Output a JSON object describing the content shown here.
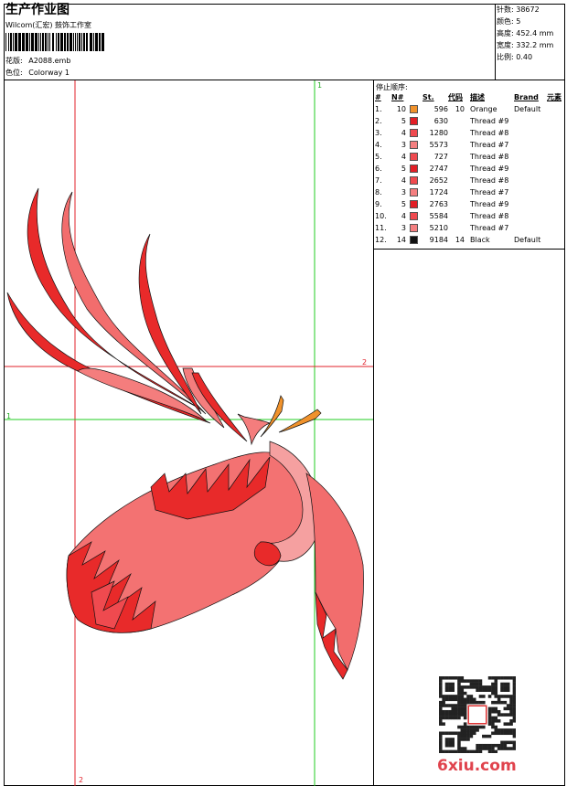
{
  "header": {
    "title": "生产作业图",
    "subtitle": "Wilcom(汇宏) 鼓饰工作室",
    "design_label": "花版:",
    "design_file": "A2088.emb",
    "color_label": "色位:",
    "colorway": "Colorway 1"
  },
  "stats": [
    {
      "label": "针数:",
      "value": "38672"
    },
    {
      "label": "颜色:",
      "value": "5"
    },
    {
      "label": "高度:",
      "value": "452.4 mm"
    },
    {
      "label": "宽度:",
      "value": "332.2 mm"
    },
    {
      "label": "比例:",
      "value": "0.40"
    }
  ],
  "stop_sequence": {
    "title": "停止顺序:",
    "headers": [
      "#",
      "N#",
      "",
      "St.",
      "代码",
      "描述",
      "Brand",
      "元素"
    ],
    "rows": [
      {
        "n": "1.",
        "needle": "10",
        "color": "#f0922c",
        "stitches": "596",
        "code": "10",
        "desc": "Orange",
        "brand": "Default"
      },
      {
        "n": "2.",
        "needle": "5",
        "color": "#e21e26",
        "stitches": "630",
        "code": "",
        "desc": "Thread #9",
        "brand": ""
      },
      {
        "n": "3.",
        "needle": "4",
        "color": "#ef4a4f",
        "stitches": "1280",
        "code": "",
        "desc": "Thread #8",
        "brand": ""
      },
      {
        "n": "4.",
        "needle": "3",
        "color": "#f47f80",
        "stitches": "5573",
        "code": "",
        "desc": "Thread #7",
        "brand": ""
      },
      {
        "n": "5.",
        "needle": "4",
        "color": "#ef4a4f",
        "stitches": "727",
        "code": "",
        "desc": "Thread #8",
        "brand": ""
      },
      {
        "n": "6.",
        "needle": "5",
        "color": "#e21e26",
        "stitches": "2747",
        "code": "",
        "desc": "Thread #9",
        "brand": ""
      },
      {
        "n": "7.",
        "needle": "4",
        "color": "#ef4a4f",
        "stitches": "2652",
        "code": "",
        "desc": "Thread #8",
        "brand": ""
      },
      {
        "n": "8.",
        "needle": "3",
        "color": "#f47f80",
        "stitches": "1724",
        "code": "",
        "desc": "Thread #7",
        "brand": ""
      },
      {
        "n": "9.",
        "needle": "5",
        "color": "#e21e26",
        "stitches": "2763",
        "code": "",
        "desc": "Thread #9",
        "brand": ""
      },
      {
        "n": "10.",
        "needle": "4",
        "color": "#ef4a4f",
        "stitches": "5584",
        "code": "",
        "desc": "Thread #8",
        "brand": ""
      },
      {
        "n": "11.",
        "needle": "3",
        "color": "#f47f80",
        "stitches": "5210",
        "code": "",
        "desc": "Thread #7",
        "brand": ""
      },
      {
        "n": "12.",
        "needle": "14",
        "color": "#111111",
        "stitches": "9184",
        "code": "14",
        "desc": "Black",
        "brand": "Default"
      }
    ]
  },
  "guides": {
    "v1": "1",
    "v2": "2",
    "h1": "1",
    "h2": "2"
  },
  "watermark": "6xiu.com",
  "colors": {
    "guide_red": "#e0202a",
    "guide_green": "#22cc22",
    "design_red": "#ee2222",
    "design_pink": "#f37a7a"
  }
}
